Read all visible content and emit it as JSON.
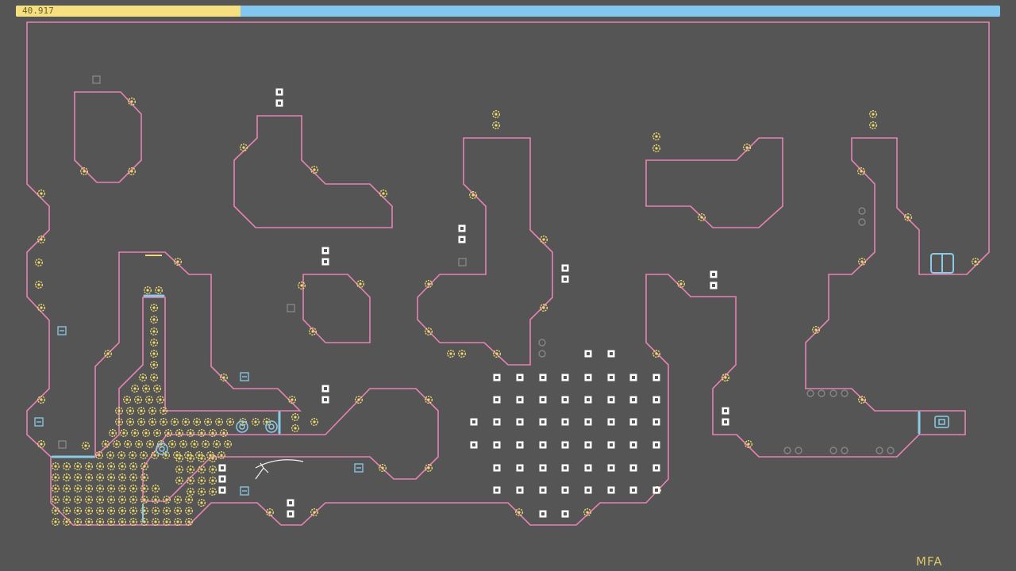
{
  "hud": {
    "time_remaining": "40.917",
    "time_fraction": 0.228,
    "level_name": "MFA"
  },
  "colors": {
    "background": "#555555",
    "wall_outline": "#e882b4",
    "gold": "#eedb6c",
    "mine": "#ffffff",
    "drone": "#8ccbe6",
    "inactive": "#8c8c8c",
    "timer_remaining": "#f6df7e",
    "timer_track": "#82c8ee"
  },
  "icons": {
    "gold": "gold-icon",
    "mine": "mine-icon",
    "switch": "switch-icon",
    "exit": "exit-door-icon",
    "drone": "drone-icon",
    "ninja": "ninja-icon"
  }
}
